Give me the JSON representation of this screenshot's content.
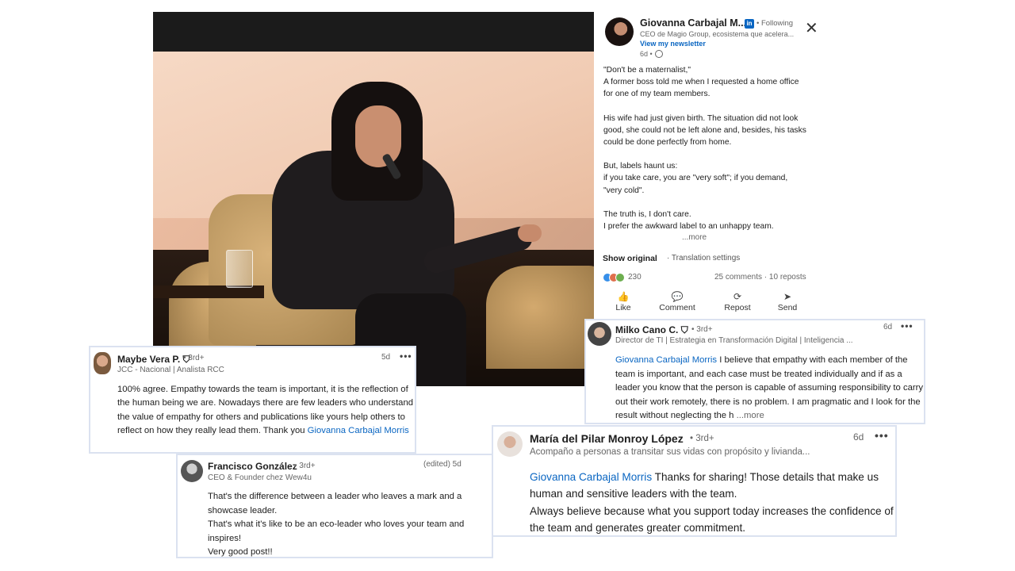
{
  "post": {
    "author_name": "Giovanna Carbajal M...",
    "linkedin_badge": "in",
    "following": "• Following",
    "author_headline": "CEO de Magio Group, ecosistema que acelera...",
    "newsletter_link": "View my newsletter",
    "time": "6d •",
    "close_symbol": "✕",
    "paragraphs": [
      "\"Don't be a maternalist,\"\nA former boss told me when I requested a home office\nfor one of my team members.",
      "His wife had just given birth. The situation did not look\ngood, she could not be left alone and, besides, his tasks\ncould be done perfectly from home.",
      "But, labels haunt us:\nif you take care, you are \"very soft\"; if you demand,\n\"very cold\".",
      "The truth is, I don't care.\nI prefer the awkward label to an unhappy team."
    ],
    "more": "...more",
    "show_original": "Show original",
    "translation_settings": "· Translation settings",
    "reaction_count": "230",
    "comments_reposts": "25 comments · 10 reposts",
    "actions": [
      {
        "label": "Like",
        "icon": "like-icon"
      },
      {
        "label": "Comment",
        "icon": "comment-icon"
      },
      {
        "label": "Repost",
        "icon": "repost-icon"
      },
      {
        "label": "Send",
        "icon": "send-icon"
      }
    ],
    "reaction_colors": [
      "#378fe9",
      "#df704d",
      "#6dae4f"
    ]
  },
  "comments": {
    "maybe": {
      "name": "Maybe Vera P.",
      "degree": "• 3rd+",
      "headline": "JCC - Nacional | Analista RCC",
      "time": "5d",
      "dots": "•••",
      "text": "100% agree. Empathy towards the team is important, it is the reflection of the human being we are. Nowadays there are few leaders who understand the value of empathy for others and publications like yours help others to reflect on how they really lead them. Thank you ",
      "mention": "Giovanna Carbajal Morris"
    },
    "francisco": {
      "name": "Francisco González",
      "degree": "• 3rd+",
      "headline": "CEO & Founder chez Wew4u",
      "time": "(edited) 5d",
      "text": "That's the difference between a leader who leaves a mark and a showcase leader.\nThat's what it's like to be an eco-leader who loves your team and inspires!\nVery good post!!"
    },
    "milko": {
      "name": "Milko Cano C.",
      "degree": "• 3rd+",
      "headline": "Director de TI | Estrategia en Transformación Digital | Inteligencia ...",
      "time": "6d",
      "dots": "•••",
      "mention": "Giovanna Carbajal Morris",
      "text": " I believe that empathy with each member of the team is important, and each case must be treated individually and if as a leader you know that the person is capable of assuming responsibility to carry out their work remotely, there is no problem. I am pragmatic and I look for the result without neglecting the h",
      "more": " ...more"
    },
    "maria": {
      "name": "María del Pilar Monroy López",
      "degree": "• 3rd+",
      "headline": "Acompaño a personas a transitar sus vidas con propósito y livianda...",
      "time": "6d",
      "dots": "•••",
      "mention": "Giovanna Carbajal Morris",
      "text1": " Thanks for sharing! Those details that make us human and sensitive leaders with the team.",
      "text2": "Always believe because what you support today increases the confidence of the team and generates greater commitment."
    }
  }
}
